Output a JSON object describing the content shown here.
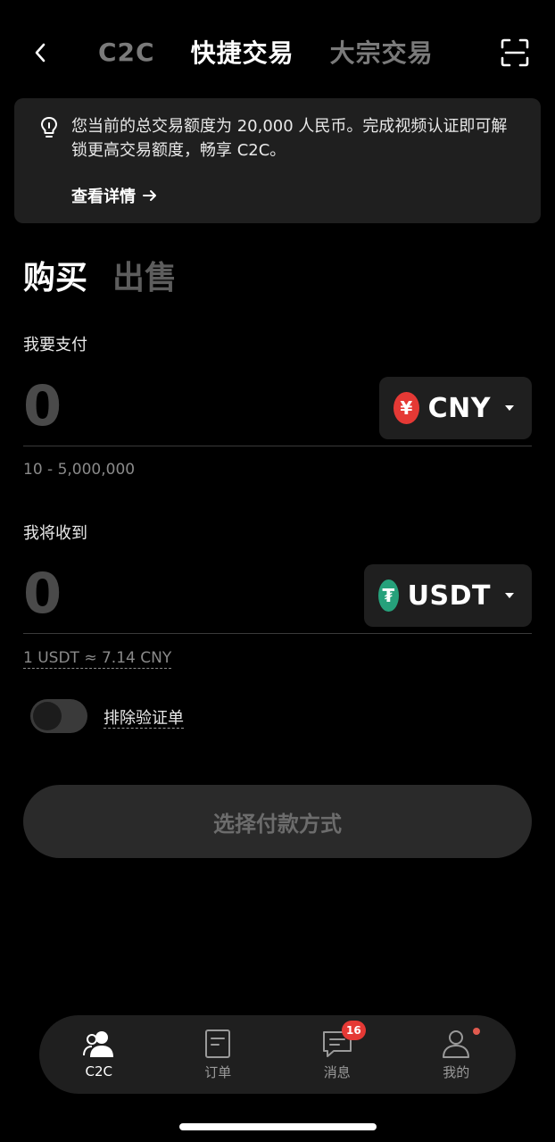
{
  "header": {
    "tabs": [
      {
        "label": "C2C",
        "active": false
      },
      {
        "label": "快捷交易",
        "active": true
      },
      {
        "label": "大宗交易",
        "active": false
      }
    ],
    "back_icon": "chevron-left-icon",
    "scan_icon": "scan-icon"
  },
  "notice": {
    "icon": "lightbulb-icon",
    "text": "您当前的总交易额度为 20,000 人民币。完成视频认证即可解锁更高交易额度，畅享 C2C。",
    "link_label": "查看详情"
  },
  "trade_mode": {
    "tabs": [
      {
        "label": "购买",
        "active": true
      },
      {
        "label": "出售",
        "active": false
      }
    ]
  },
  "pay": {
    "label": "我要支付",
    "amount": "0",
    "currency": "CNY",
    "currency_symbol": "¥",
    "currency_color": "#e53935",
    "range": "10 - 5,000,000"
  },
  "receive": {
    "label": "我将收到",
    "amount": "0",
    "currency": "USDT",
    "currency_symbol": "₮",
    "currency_color": "#26a17b",
    "rate": "1 USDT ≈ 7.14 CNY"
  },
  "filter": {
    "label": "排除验证单",
    "enabled": false
  },
  "cta": {
    "label": "选择付款方式"
  },
  "bottom_nav": {
    "items": [
      {
        "label": "C2C",
        "icon": "users-icon",
        "active": true
      },
      {
        "label": "订单",
        "icon": "order-icon",
        "active": false
      },
      {
        "label": "消息",
        "icon": "message-icon",
        "active": false,
        "badge": "16"
      },
      {
        "label": "我的",
        "icon": "profile-icon",
        "active": false,
        "dot": true
      }
    ]
  }
}
